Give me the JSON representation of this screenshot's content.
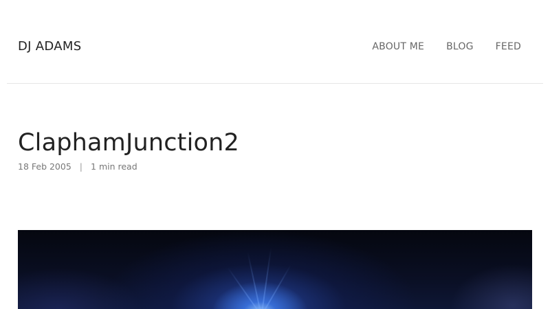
{
  "site": {
    "title": "DJ ADAMS"
  },
  "nav": {
    "items": [
      {
        "label": "ABOUT ME"
      },
      {
        "label": "BLOG"
      },
      {
        "label": "FEED"
      }
    ]
  },
  "post": {
    "title": "ClaphamJunction2",
    "date": "18 Feb 2005",
    "separator": "|",
    "read_time": "1 min read",
    "image_alt": "ClaphamJunction2"
  }
}
